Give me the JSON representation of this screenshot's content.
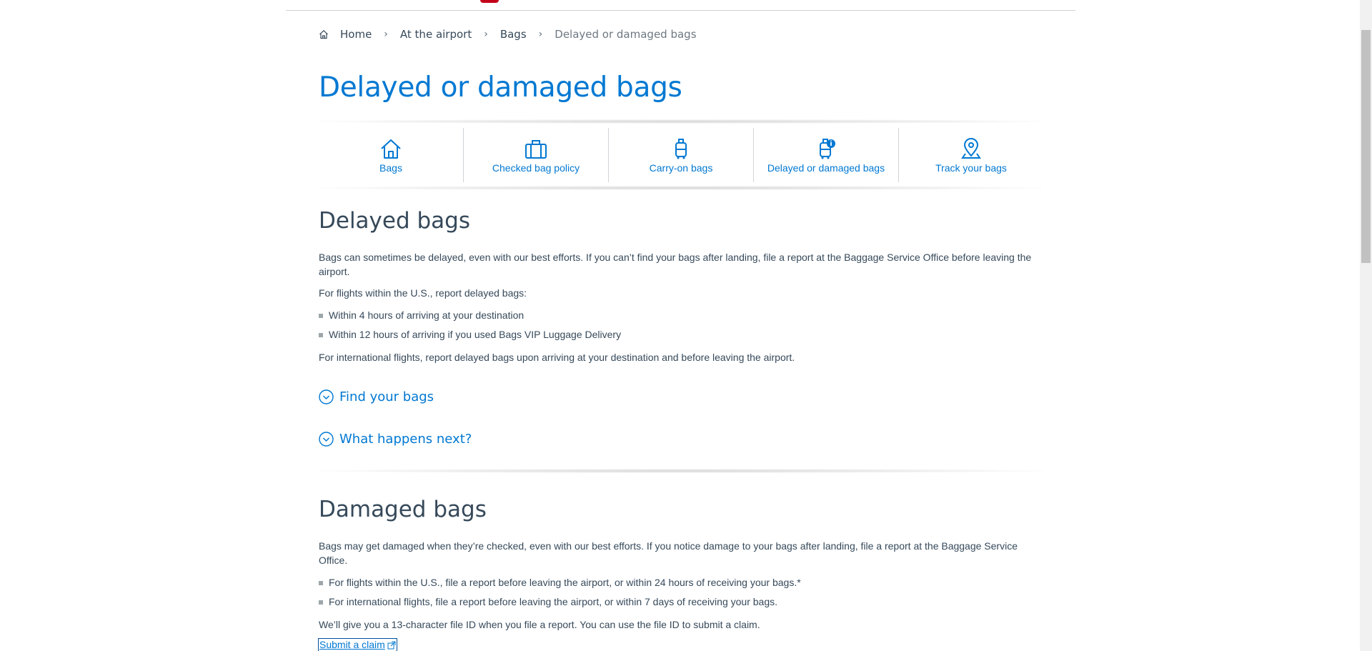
{
  "breadcrumb": {
    "items": [
      "Home",
      "At the airport",
      "Bags"
    ],
    "current": "Delayed or damaged bags"
  },
  "page_title": "Delayed or damaged bags",
  "nav_tiles": [
    {
      "label": "Bags",
      "icon": "house-icon"
    },
    {
      "label": "Checked bag policy",
      "icon": "suitcase-icon"
    },
    {
      "label": "Carry-on bags",
      "icon": "carry-on-icon"
    },
    {
      "label": "Delayed or damaged bags",
      "icon": "bag-info-icon"
    },
    {
      "label": "Track your bags",
      "icon": "location-pin-icon"
    }
  ],
  "delayed": {
    "heading": "Delayed bags",
    "intro": "Bags can sometimes be delayed, even with our best efforts. If you can’t find your bags after landing, file a report at the Baggage Service Office before leaving the airport.",
    "us_intro": "For flights within the U.S., report delayed bags:",
    "bullets": [
      "Within 4 hours of arriving at your destination",
      "Within 12 hours of arriving if you used Bags VIP Luggage Delivery"
    ],
    "intl": "For international flights, report delayed bags upon arriving at your destination and before leaving the airport.",
    "accordions": [
      "Find your bags",
      "What happens next?"
    ]
  },
  "damaged": {
    "heading": "Damaged bags",
    "intro": "Bags may get damaged when they’re checked, even with our best efforts. If you notice damage to your bags after landing, file a report at the Baggage Service Office.",
    "bullets": [
      "For flights within the U.S., file a report before leaving the airport, or within 24 hours of receiving your bags.*",
      "For international flights, file a report before leaving the airport, or within 7 days of receiving your bags."
    ],
    "file_id": "We’ll give you a 13-character file ID when you file a report. You can use the file ID to submit a claim.",
    "claim_link": "Submit a claim"
  },
  "colors": {
    "brand_blue": "#0078d2",
    "text": "#36495a",
    "logo_red": "#c30019"
  }
}
